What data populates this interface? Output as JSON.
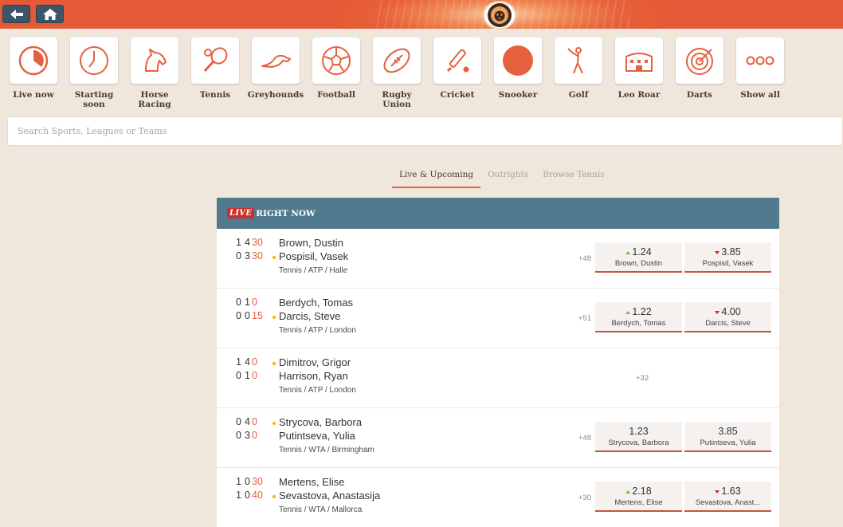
{
  "sports": [
    {
      "label": "Live now",
      "icon": "live-now-icon"
    },
    {
      "label": "Starting soon",
      "icon": "clock-icon"
    },
    {
      "label": "Horse Racing",
      "icon": "horse-icon"
    },
    {
      "label": "Tennis",
      "icon": "tennis-icon"
    },
    {
      "label": "Greyhounds",
      "icon": "greyhound-icon"
    },
    {
      "label": "Football",
      "icon": "football-icon"
    },
    {
      "label": "Rugby Union",
      "icon": "rugby-ball-icon"
    },
    {
      "label": "Cricket",
      "icon": "cricket-icon"
    },
    {
      "label": "Snooker",
      "icon": "snooker-ball-icon"
    },
    {
      "label": "Golf",
      "icon": "golfer-icon"
    },
    {
      "label": "Leo Roar",
      "icon": "stadium-icon"
    },
    {
      "label": "Darts",
      "icon": "dartboard-icon"
    },
    {
      "label": "Show all",
      "icon": "more-icon"
    }
  ],
  "search": {
    "placeholder": "Search Sports, Leagues or Teams"
  },
  "tabs": [
    {
      "label": "Live & Upcoming",
      "active": true
    },
    {
      "label": "Outrights",
      "active": false
    },
    {
      "label": "Browse Tennis",
      "active": false
    }
  ],
  "panel": {
    "live_badge": "LIVE",
    "title": "RIGHT NOW"
  },
  "colors": {
    "accent": "#e4603e",
    "header": "#527a8e",
    "topbar": "#e8613a"
  },
  "matches": [
    {
      "p1": {
        "name": "Brown, Dustin",
        "sets": "1",
        "games": "4",
        "points": "30"
      },
      "p2": {
        "name": "Pospisil, Vasek",
        "sets": "0",
        "games": "3",
        "points": "30"
      },
      "server": 2,
      "league": "Tennis / ATP / Halle",
      "more": "+48",
      "odds": [
        {
          "value": "1.24",
          "name": "Brown, Dustin",
          "trend": "up"
        },
        {
          "value": "3.85",
          "name": "Pospisil, Vasek",
          "trend": "down"
        }
      ]
    },
    {
      "p1": {
        "name": "Berdych, Tomas",
        "sets": "0",
        "games": "1",
        "points": "0"
      },
      "p2": {
        "name": "Darcis, Steve",
        "sets": "0",
        "games": "0",
        "points": "15"
      },
      "server": 2,
      "league": "Tennis / ATP / London",
      "more": "+51",
      "odds": [
        {
          "value": "1.22",
          "name": "Berdych, Tomas",
          "trend": "up"
        },
        {
          "value": "4.00",
          "name": "Darcis, Steve",
          "trend": "down"
        }
      ]
    },
    {
      "p1": {
        "name": "Dimitrov, Grigor",
        "sets": "1",
        "games": "4",
        "points": "0"
      },
      "p2": {
        "name": "Harrison, Ryan",
        "sets": "0",
        "games": "1",
        "points": "0"
      },
      "server": 1,
      "league": "Tennis / ATP / London",
      "more": "+32",
      "odds": []
    },
    {
      "p1": {
        "name": "Strycova, Barbora",
        "sets": "0",
        "games": "4",
        "points": "0"
      },
      "p2": {
        "name": "Putintseva, Yulia",
        "sets": "0",
        "games": "3",
        "points": "0"
      },
      "server": 1,
      "league": "Tennis / WTA / Birmingham",
      "more": "+48",
      "odds": [
        {
          "value": "1.23",
          "name": "Strycova, Barbora",
          "trend": "none"
        },
        {
          "value": "3.85",
          "name": "Putintseva, Yulia",
          "trend": "none"
        }
      ]
    },
    {
      "p1": {
        "name": "Mertens, Elise",
        "sets": "1",
        "games": "0",
        "points": "30"
      },
      "p2": {
        "name": "Sevastova, Anastasija",
        "sets": "1",
        "games": "0",
        "points": "40"
      },
      "server": 2,
      "league": "Tennis / WTA / Mallorca",
      "more": "+30",
      "odds": [
        {
          "value": "2.18",
          "name": "Mertens, Elise",
          "trend": "up"
        },
        {
          "value": "1.63",
          "name": "Sevastova, Anast...",
          "trend": "down"
        }
      ]
    }
  ]
}
